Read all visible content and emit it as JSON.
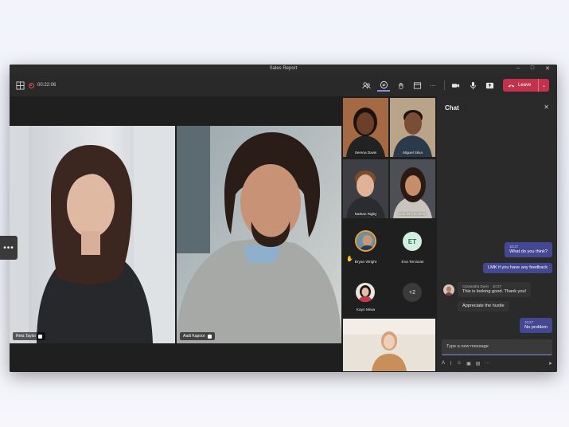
{
  "window": {
    "title": "Sales Report",
    "controls": {
      "minimize": "–",
      "maximize": "□",
      "close": "✕"
    }
  },
  "toolbar": {
    "timer": "00:22:06",
    "leave_label": "Leave",
    "leave_caret": "⌄",
    "icons": [
      "grid-icon",
      "record-icon",
      "people-icon",
      "chat-icon",
      "reactions-icon",
      "share-tray-icon",
      "more-icon",
      "camera-icon",
      "mic-icon",
      "share-icon",
      "leave-phone-icon"
    ],
    "accent": "#c4314b"
  },
  "stage": {
    "participants": [
      {
        "name": "Reta Taylor"
      },
      {
        "name": "Aadi Kapoor"
      }
    ]
  },
  "gallery": {
    "tiles": [
      {
        "name": "Serena Davis"
      },
      {
        "name": "Miguel Silva"
      },
      {
        "name": "Nathan Rigby"
      },
      {
        "name": "Danielle Booker"
      }
    ],
    "avatars": [
      {
        "name": "Bryan Wright",
        "hand_raised": true
      },
      {
        "name": "Eva Terrazas",
        "initials": "ET"
      },
      {
        "name": "Kayo Miwa"
      },
      {
        "overflow": "+2"
      }
    ]
  },
  "chat": {
    "title": "Chat",
    "close": "✕",
    "messages": [
      {
        "from": "me",
        "time": "10:27",
        "text": "What do you think?"
      },
      {
        "from": "me",
        "time": "",
        "text": "LMK if you have any feedback"
      },
      {
        "from": "other",
        "sender": "Cassandra Dunn",
        "time": "10:27",
        "text": "This is looking good. Thank you!"
      },
      {
        "from": "other",
        "sender": "",
        "time": "",
        "text": "Appreciate the hustle"
      },
      {
        "from": "me",
        "time": "10:27",
        "text": "No problem"
      }
    ],
    "compose_placeholder": "Type a new message",
    "compose_tools": [
      "A",
      "⌇",
      "☺",
      "▣",
      "▤",
      "···"
    ],
    "send": "➤"
  },
  "side_handle": "•••",
  "colors": {
    "brand": "#444791",
    "chat_accent": "#8b8cde"
  }
}
